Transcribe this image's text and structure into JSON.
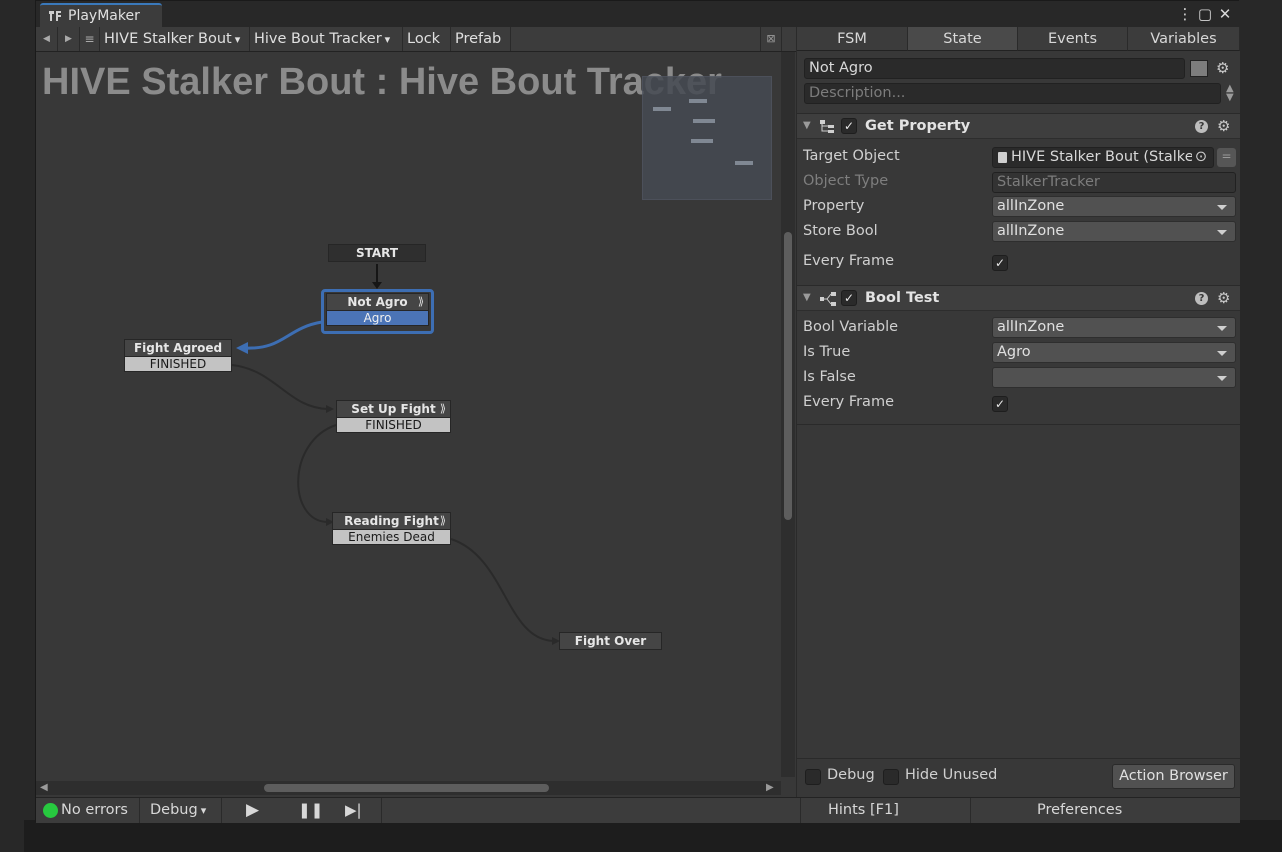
{
  "window": {
    "tab_title": "PlayMaker"
  },
  "toolbar": {
    "fsm_owner": "HIVE Stalker Bout",
    "fsm_name": "Hive Bout Tracker",
    "lock": "Lock",
    "prefab": "Prefab"
  },
  "graph": {
    "title": "HIVE Stalker Bout : Hive Bout Tracker",
    "start": "START",
    "states": [
      {
        "name": "Not Agro",
        "event": "Agro"
      },
      {
        "name": "Fight Agroed",
        "event": "FINISHED"
      },
      {
        "name": "Set Up Fight",
        "event": "FINISHED"
      },
      {
        "name": "Reading Fight",
        "event": "Enemies Dead"
      },
      {
        "name": "Fight Over",
        "event": ""
      }
    ]
  },
  "panel": {
    "tabs": [
      "FSM",
      "State",
      "Events",
      "Variables"
    ],
    "active_tab": "State",
    "state_name": "Not Agro",
    "description_placeholder": "Description...",
    "actions": [
      {
        "title": "Get Property",
        "rows": {
          "target_object_label": "Target Object",
          "target_object_value": "HIVE Stalker Bout (Stalke",
          "object_type_label": "Object Type",
          "object_type_value": "StalkerTracker",
          "property_label": "Property",
          "property_value": "allInZone",
          "store_bool_label": "Store Bool",
          "store_bool_value": "allInZone",
          "every_frame_label": "Every Frame"
        }
      },
      {
        "title": "Bool Test",
        "rows": {
          "bool_variable_label": "Bool Variable",
          "bool_variable_value": "allInZone",
          "is_true_label": "Is True",
          "is_true_value": "Agro",
          "is_false_label": "Is False",
          "is_false_value": "",
          "every_frame_label": "Every Frame"
        }
      }
    ],
    "footer": {
      "debug": "Debug",
      "hide_unused": "Hide Unused",
      "action_browser": "Action Browser"
    }
  },
  "statusbar": {
    "errors": "No errors",
    "mode": "Debug",
    "hints": "Hints [F1]",
    "preferences": "Preferences"
  },
  "colors": {
    "accent": "#4b74b6",
    "status_ok": "#27c93f"
  }
}
